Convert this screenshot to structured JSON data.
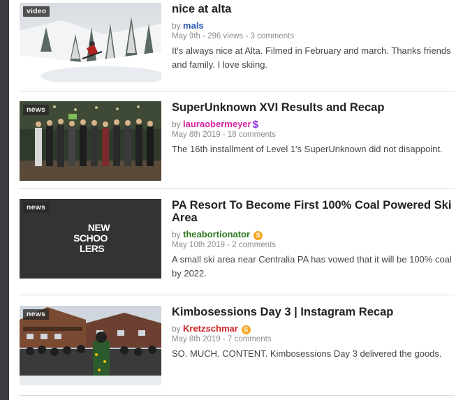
{
  "articles": [
    {
      "badge": "video",
      "title": "nice at alta",
      "by": "by",
      "user": "mals",
      "user_color": "#2a5db0",
      "meta": "May 9th - 296 views - 3 comments",
      "desc": "It's always nice at Alta. Filmed in February and march. Thanks friends and family. I love skiing."
    },
    {
      "badge": "news",
      "title": "SuperUnknown XVI Results and Recap",
      "by": "by",
      "user": "lauraobermeyer",
      "user_color": "#d6249f",
      "user_icon": "$",
      "meta": "May 8th 2019 - 18 comments",
      "desc": "The 16th installment of Level 1's SuperUnknown did not disappoint."
    },
    {
      "badge": "news",
      "title": "PA Resort To Become First 100% Coal Powered Ski Area",
      "by": "by",
      "user": "theabortionator",
      "user_color": "#2b7a1d",
      "user_icon": "S",
      "meta": "May 10th 2019 - 2 comments",
      "desc": "A small ski area near Centralia PA has vowed that it will be 100% coal by 2022.",
      "thumb_logo": [
        "NEW",
        "SCHOO",
        "LERS"
      ]
    },
    {
      "badge": "news",
      "title": "Kimbosessions Day 3 | Instagram Recap",
      "by": "by",
      "user": "Kretzschmar",
      "user_color": "#cc2222",
      "user_icon": "S",
      "meta": "May 8th 2019 - 7 comments",
      "desc": "SO. MUCH. CONTENT. Kimbosessions Day 3 delivered the goods."
    }
  ],
  "colors": {
    "dollar": "#8a2be2",
    "coin": "#f5a623"
  }
}
